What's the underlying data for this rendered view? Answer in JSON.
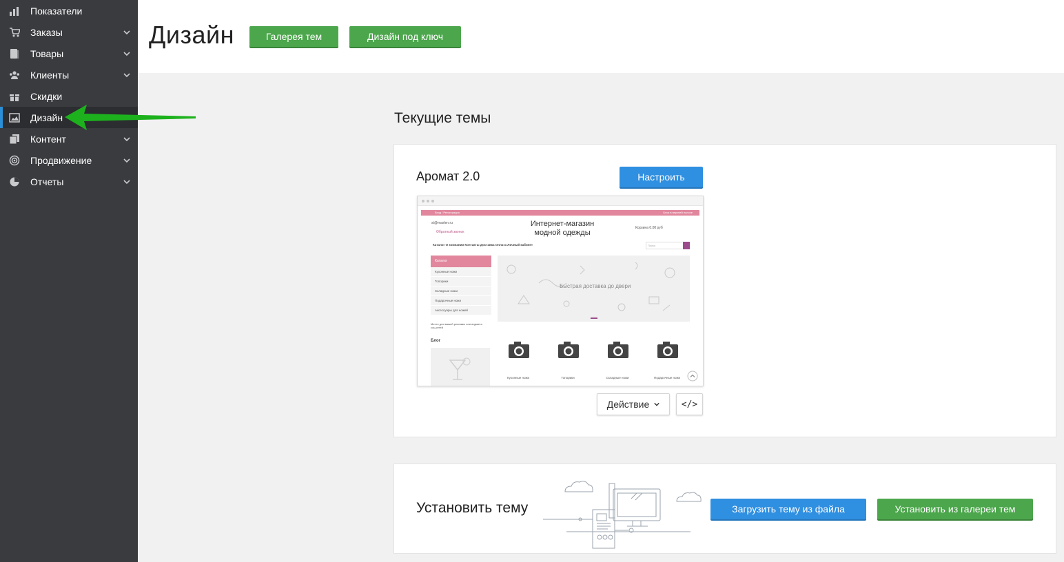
{
  "sidebar": {
    "items": [
      {
        "label": "Показатели",
        "icon": "bar-chart-icon",
        "has_chevron": false,
        "active": false
      },
      {
        "label": "Заказы",
        "icon": "cart-icon",
        "has_chevron": true,
        "active": false
      },
      {
        "label": "Товары",
        "icon": "book-icon",
        "has_chevron": true,
        "active": false
      },
      {
        "label": "Клиенты",
        "icon": "users-icon",
        "has_chevron": true,
        "active": false
      },
      {
        "label": "Скидки",
        "icon": "gift-icon",
        "has_chevron": false,
        "active": false
      },
      {
        "label": "Дизайн",
        "icon": "image-icon",
        "has_chevron": false,
        "active": true
      },
      {
        "label": "Контент",
        "icon": "pages-icon",
        "has_chevron": true,
        "active": false
      },
      {
        "label": "Продвижение",
        "icon": "target-icon",
        "has_chevron": true,
        "active": false
      },
      {
        "label": "Отчеты",
        "icon": "pie-chart-icon",
        "has_chevron": true,
        "active": false
      }
    ]
  },
  "header": {
    "title": "Дизайн",
    "gallery_button": "Галерея тем",
    "turnkey_button": "Дизайн под ключ"
  },
  "current_themes": {
    "title": "Текущие темы",
    "theme_name": "Аромат 2.0",
    "configure_button": "Настроить",
    "action_button": "Действие",
    "code_button": "</>",
    "preview": {
      "top_left": "Вход / Регистрация",
      "top_right": "Блок в верхней полосе",
      "email": "st@maxlen.ru",
      "callback": "Обратный звонок",
      "shop_title_line1": "Интернет-магазин",
      "shop_title_line2": "модной одежды",
      "cart_text": "Корзина  0.00 руб",
      "menu": "Каталог   О компании   Контакты   Доставка   Оплата   Личный кабинет",
      "search_placeholder": "Поиск",
      "catalog_label": "Каталог",
      "categories": [
        "Кухонные ножи",
        "Топорики",
        "Складные ножи",
        "Подарочные ножи",
        "Аксессуары для ножей"
      ],
      "ad_text": "Место для вашей рекламы или виджета соц.сетей",
      "banner_text": "Быстрая доставка до двери",
      "blog_label": "Блог",
      "products": [
        "Кухонные ножи",
        "Топорики",
        "Складные ножи",
        "Подарочные ножи"
      ]
    }
  },
  "install": {
    "title": "Установить тему",
    "upload_button": "Загрузить тему из файла",
    "gallery_button": "Установить из галереи тем"
  },
  "colors": {
    "sidebar_bg": "#3a3b3f",
    "green": "#4ca64c",
    "blue": "#2f8fe0",
    "arrow": "#1db21d",
    "preview_pink": "#e1869d"
  }
}
